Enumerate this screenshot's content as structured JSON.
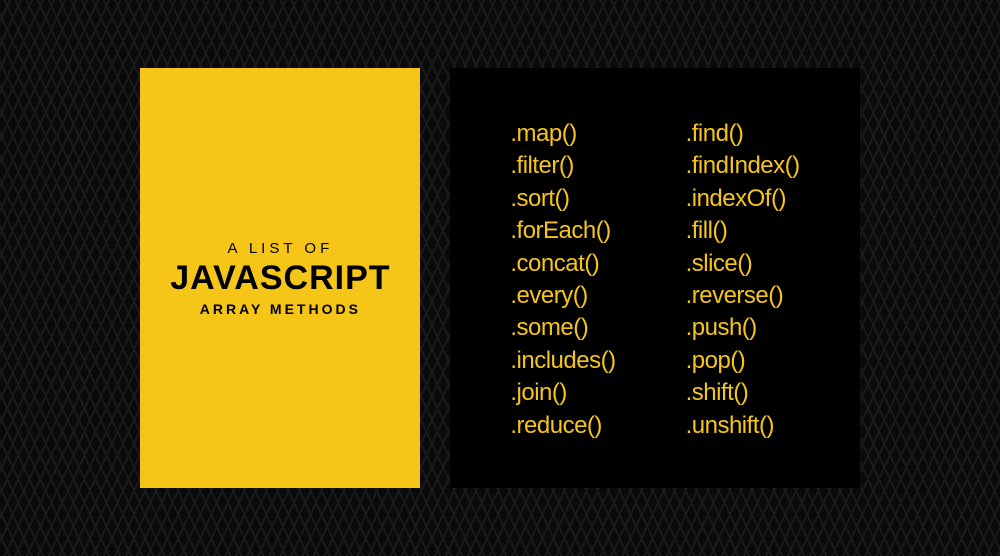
{
  "header": {
    "subtitle": "A LIST OF",
    "title": "JAVASCRIPT",
    "footer": "ARRAY METHODS"
  },
  "methods": {
    "column1": [
      ".map()",
      ".filter()",
      ".sort()",
      ".forEach()",
      ".concat()",
      ".every()",
      ".some()",
      ".includes()",
      ".join()",
      ".reduce()"
    ],
    "column2": [
      ".find()",
      ".findIndex()",
      ".indexOf()",
      ".fill()",
      ".slice()",
      ".reverse()",
      ".push()",
      ".pop()",
      ".shift()",
      ".unshift()"
    ]
  }
}
